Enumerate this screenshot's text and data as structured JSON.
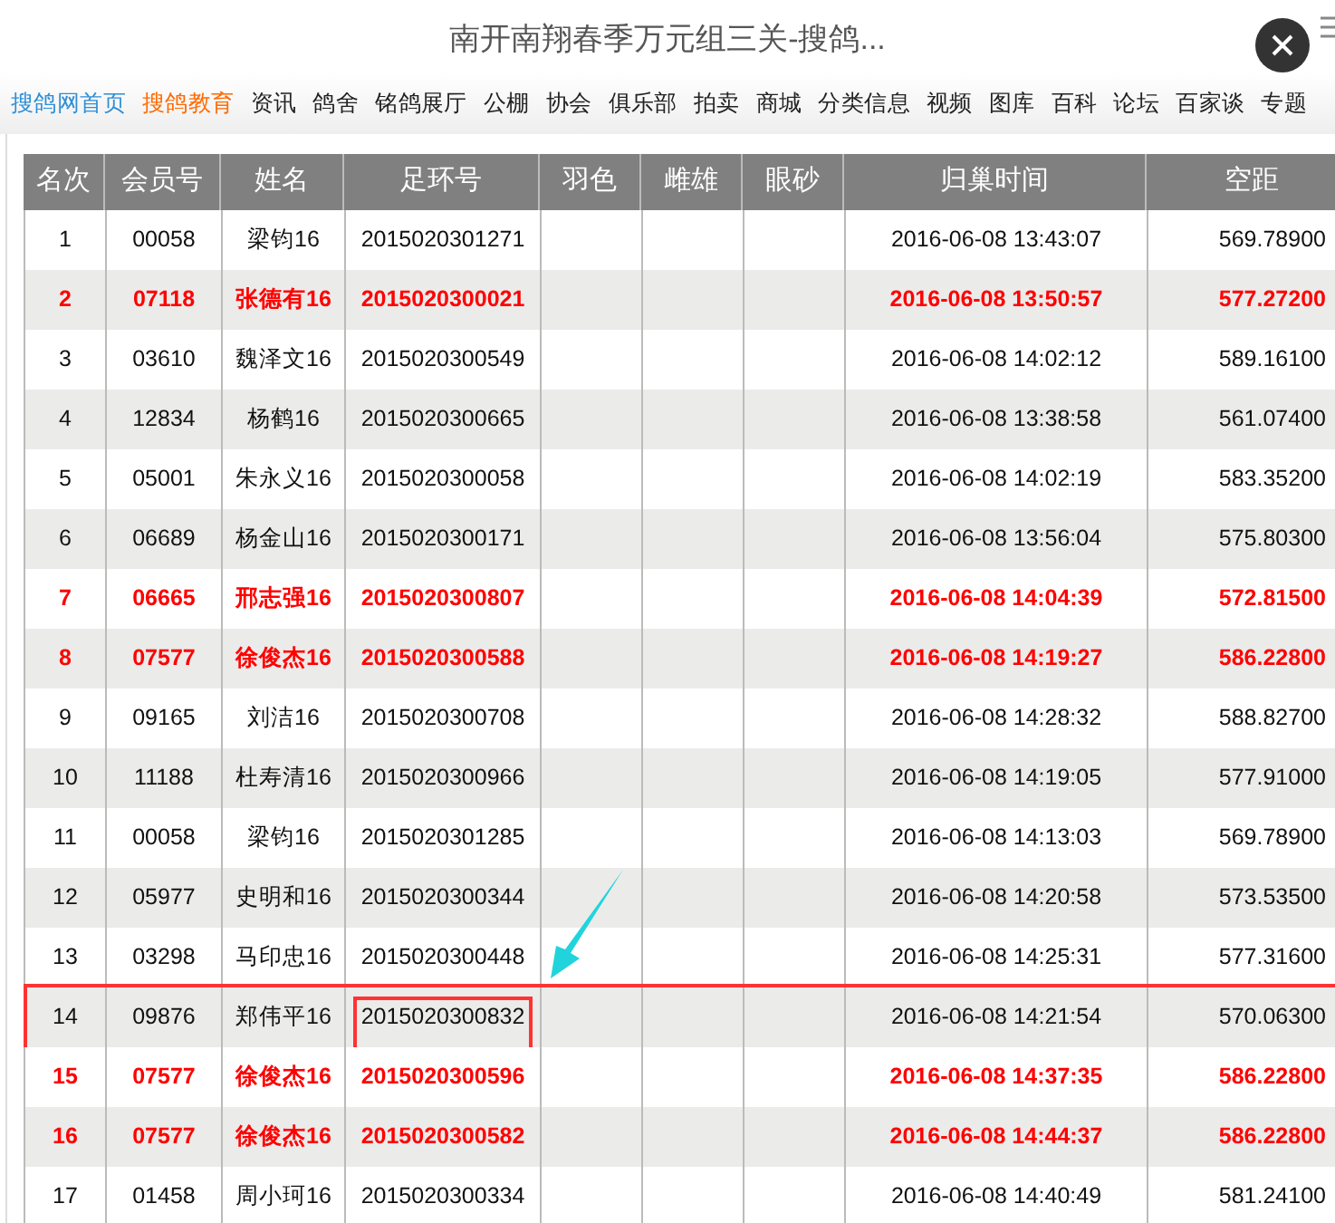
{
  "title": "南开南翔春季万元组三关-搜鸽...",
  "nav": [
    {
      "label": "搜鸽网首页",
      "color": "#2f8fd6"
    },
    {
      "label": "搜鸽教育",
      "color": "#ff6a00"
    },
    {
      "label": "资讯",
      "color": "#222222"
    },
    {
      "label": "鸽舍",
      "color": "#222222"
    },
    {
      "label": "铭鸽展厅",
      "color": "#222222"
    },
    {
      "label": "公棚",
      "color": "#222222"
    },
    {
      "label": "协会",
      "color": "#222222"
    },
    {
      "label": "俱乐部",
      "color": "#222222"
    },
    {
      "label": "拍卖",
      "color": "#222222"
    },
    {
      "label": "商城",
      "color": "#222222"
    },
    {
      "label": "分类信息",
      "color": "#222222"
    },
    {
      "label": "视频",
      "color": "#222222"
    },
    {
      "label": "图库",
      "color": "#222222"
    },
    {
      "label": "百科",
      "color": "#222222"
    },
    {
      "label": "论坛",
      "color": "#222222"
    },
    {
      "label": "百家谈",
      "color": "#222222"
    },
    {
      "label": "专题",
      "color": "#222222"
    }
  ],
  "table": {
    "columns": [
      "名次",
      "会员号",
      "姓名",
      "足环号",
      "羽色",
      "雌雄",
      "眼砂",
      "归巢时间",
      "空距"
    ],
    "rows": [
      {
        "cells": [
          "1",
          "00058",
          "梁钧16",
          "2015020301271",
          "",
          "",
          "",
          "2016-06-08 13:43:07",
          "569.78900"
        ],
        "highlighted": false,
        "marked": false
      },
      {
        "cells": [
          "2",
          "07118",
          "张德有16",
          "2015020300021",
          "",
          "",
          "",
          "2016-06-08 13:50:57",
          "577.27200"
        ],
        "highlighted": true,
        "marked": false
      },
      {
        "cells": [
          "3",
          "03610",
          "魏泽文16",
          "2015020300549",
          "",
          "",
          "",
          "2016-06-08 14:02:12",
          "589.16100"
        ],
        "highlighted": false,
        "marked": false
      },
      {
        "cells": [
          "4",
          "12834",
          "杨鹤16",
          "2015020300665",
          "",
          "",
          "",
          "2016-06-08 13:38:58",
          "561.07400"
        ],
        "highlighted": false,
        "marked": false
      },
      {
        "cells": [
          "5",
          "05001",
          "朱永义16",
          "2015020300058",
          "",
          "",
          "",
          "2016-06-08 14:02:19",
          "583.35200"
        ],
        "highlighted": false,
        "marked": false
      },
      {
        "cells": [
          "6",
          "06689",
          "杨金山16",
          "2015020300171",
          "",
          "",
          "",
          "2016-06-08 13:56:04",
          "575.80300"
        ],
        "highlighted": false,
        "marked": false
      },
      {
        "cells": [
          "7",
          "06665",
          "邢志强16",
          "2015020300807",
          "",
          "",
          "",
          "2016-06-08 14:04:39",
          "572.81500"
        ],
        "highlighted": true,
        "marked": false
      },
      {
        "cells": [
          "8",
          "07577",
          "徐俊杰16",
          "2015020300588",
          "",
          "",
          "",
          "2016-06-08 14:19:27",
          "586.22800"
        ],
        "highlighted": true,
        "marked": false
      },
      {
        "cells": [
          "9",
          "09165",
          "刘洁16",
          "2015020300708",
          "",
          "",
          "",
          "2016-06-08 14:28:32",
          "588.82700"
        ],
        "highlighted": false,
        "marked": false
      },
      {
        "cells": [
          "10",
          "11188",
          "杜寿清16",
          "2015020300966",
          "",
          "",
          "",
          "2016-06-08 14:19:05",
          "577.91000"
        ],
        "highlighted": false,
        "marked": false
      },
      {
        "cells": [
          "11",
          "00058",
          "梁钧16",
          "2015020301285",
          "",
          "",
          "",
          "2016-06-08 14:13:03",
          "569.78900"
        ],
        "highlighted": false,
        "marked": false
      },
      {
        "cells": [
          "12",
          "05977",
          "史明和16",
          "2015020300344",
          "",
          "",
          "",
          "2016-06-08 14:20:58",
          "573.53500"
        ],
        "highlighted": false,
        "marked": false
      },
      {
        "cells": [
          "13",
          "03298",
          "马印忠16",
          "2015020300448",
          "",
          "",
          "",
          "2016-06-08 14:25:31",
          "577.31600"
        ],
        "highlighted": false,
        "marked": false
      },
      {
        "cells": [
          "14",
          "09876",
          "郑伟平16",
          "2015020300832",
          "",
          "",
          "",
          "2016-06-08 14:21:54",
          "570.06300"
        ],
        "highlighted": false,
        "marked": true
      },
      {
        "cells": [
          "15",
          "07577",
          "徐俊杰16",
          "2015020300596",
          "",
          "",
          "",
          "2016-06-08 14:37:35",
          "586.22800"
        ],
        "highlighted": true,
        "marked": false
      },
      {
        "cells": [
          "16",
          "07577",
          "徐俊杰16",
          "2015020300582",
          "",
          "",
          "",
          "2016-06-08 14:44:37",
          "586.22800"
        ],
        "highlighted": true,
        "marked": false
      },
      {
        "cells": [
          "17",
          "01458",
          "周小珂16",
          "2015020300334",
          "",
          "",
          "",
          "2016-06-08 14:40:49",
          "581.24100"
        ],
        "highlighted": false,
        "marked": false
      }
    ]
  }
}
